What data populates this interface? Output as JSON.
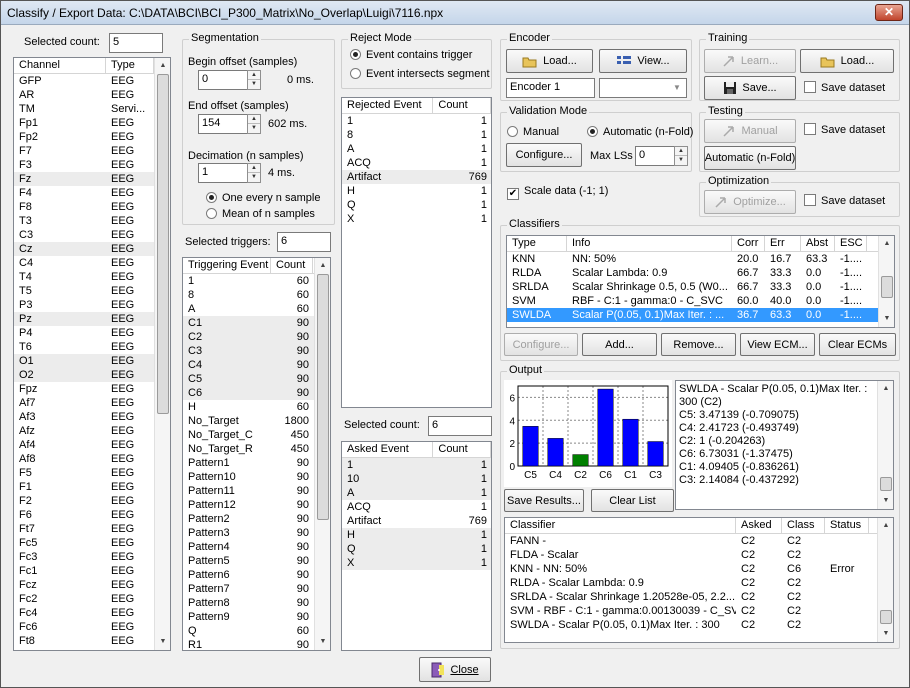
{
  "window": {
    "title": "Classify / Export Data: C:\\DATA\\BCI\\BCI_P300_Matrix\\No_Overlap\\Luigi\\7116.npx",
    "close_glyph": "✕"
  },
  "channels": {
    "selected_count_label": "Selected count:",
    "selected_count": "5",
    "headers": [
      "Channel",
      "Type"
    ],
    "rows": [
      [
        "GFP",
        "EEG",
        0
      ],
      [
        "AR",
        "EEG",
        0
      ],
      [
        "TM",
        "Servi...",
        0
      ],
      [
        "Fp1",
        "EEG",
        0
      ],
      [
        "Fp2",
        "EEG",
        0
      ],
      [
        "F7",
        "EEG",
        0
      ],
      [
        "F3",
        "EEG",
        0
      ],
      [
        "Fz",
        "EEG",
        1
      ],
      [
        "F4",
        "EEG",
        0
      ],
      [
        "F8",
        "EEG",
        0
      ],
      [
        "T3",
        "EEG",
        0
      ],
      [
        "C3",
        "EEG",
        0
      ],
      [
        "Cz",
        "EEG",
        1
      ],
      [
        "C4",
        "EEG",
        0
      ],
      [
        "T4",
        "EEG",
        0
      ],
      [
        "T5",
        "EEG",
        0
      ],
      [
        "P3",
        "EEG",
        0
      ],
      [
        "Pz",
        "EEG",
        1
      ],
      [
        "P4",
        "EEG",
        0
      ],
      [
        "T6",
        "EEG",
        0
      ],
      [
        "O1",
        "EEG",
        1
      ],
      [
        "O2",
        "EEG",
        1
      ],
      [
        "Fpz",
        "EEG",
        0
      ],
      [
        "Af7",
        "EEG",
        0
      ],
      [
        "Af3",
        "EEG",
        0
      ],
      [
        "Afz",
        "EEG",
        0
      ],
      [
        "Af4",
        "EEG",
        0
      ],
      [
        "Af8",
        "EEG",
        0
      ],
      [
        "F5",
        "EEG",
        0
      ],
      [
        "F1",
        "EEG",
        0
      ],
      [
        "F2",
        "EEG",
        0
      ],
      [
        "F6",
        "EEG",
        0
      ],
      [
        "Ft7",
        "EEG",
        0
      ],
      [
        "Fc5",
        "EEG",
        0
      ],
      [
        "Fc3",
        "EEG",
        0
      ],
      [
        "Fc1",
        "EEG",
        0
      ],
      [
        "Fcz",
        "EEG",
        0
      ],
      [
        "Fc2",
        "EEG",
        0
      ],
      [
        "Fc4",
        "EEG",
        0
      ],
      [
        "Fc6",
        "EEG",
        0
      ],
      [
        "Ft8",
        "EEG",
        0
      ]
    ]
  },
  "segmentation": {
    "title": "Segmentation",
    "begin_label": "Begin offset (samples)",
    "begin_value": "0",
    "begin_ms": "0 ms.",
    "end_label": "End offset (samples)",
    "end_value": "154",
    "end_ms": "602 ms.",
    "decim_label": "Decimation (n samples)",
    "decim_value": "1",
    "decim_ms": "4 ms.",
    "opt1": "One every n sample",
    "opt2": "Mean of n samples"
  },
  "triggers": {
    "selected_label": "Selected triggers:",
    "selected_value": "6",
    "headers": [
      "Triggering Event",
      "Count"
    ],
    "rows": [
      [
        "1",
        "60",
        0
      ],
      [
        "8",
        "60",
        0
      ],
      [
        "A",
        "60",
        0
      ],
      [
        "C1",
        "90",
        1
      ],
      [
        "C2",
        "90",
        1
      ],
      [
        "C3",
        "90",
        1
      ],
      [
        "C4",
        "90",
        1
      ],
      [
        "C5",
        "90",
        1
      ],
      [
        "C6",
        "90",
        1
      ],
      [
        "H",
        "60",
        0
      ],
      [
        "No_Target",
        "1800",
        0
      ],
      [
        "No_Target_C",
        "450",
        0
      ],
      [
        "No_Target_R",
        "450",
        0
      ],
      [
        "Pattern1",
        "90",
        0
      ],
      [
        "Pattern10",
        "90",
        0
      ],
      [
        "Pattern11",
        "90",
        0
      ],
      [
        "Pattern12",
        "90",
        0
      ],
      [
        "Pattern2",
        "90",
        0
      ],
      [
        "Pattern3",
        "90",
        0
      ],
      [
        "Pattern4",
        "90",
        0
      ],
      [
        "Pattern5",
        "90",
        0
      ],
      [
        "Pattern6",
        "90",
        0
      ],
      [
        "Pattern7",
        "90",
        0
      ],
      [
        "Pattern8",
        "90",
        0
      ],
      [
        "Pattern9",
        "90",
        0
      ],
      [
        "Q",
        "60",
        0
      ],
      [
        "R1",
        "90",
        0
      ]
    ]
  },
  "reject": {
    "title": "Reject Mode",
    "opt1": "Event contains trigger",
    "opt2": "Event intersects segment",
    "headers": [
      "Rejected Event",
      "Count"
    ],
    "rows": [
      [
        "1",
        "1",
        0
      ],
      [
        "8",
        "1",
        0
      ],
      [
        "A",
        "1",
        0
      ],
      [
        "ACQ",
        "1",
        0
      ],
      [
        "Artifact",
        "769",
        1
      ],
      [
        "H",
        "1",
        0
      ],
      [
        "Q",
        "1",
        0
      ],
      [
        "X",
        "1",
        0
      ]
    ]
  },
  "asked": {
    "selected_label": "Selected count:",
    "selected_value": "6",
    "headers": [
      "Asked Event",
      "Count"
    ],
    "rows": [
      [
        "1",
        "1",
        1
      ],
      [
        "10",
        "1",
        1
      ],
      [
        "A",
        "1",
        1
      ],
      [
        "ACQ",
        "1",
        0
      ],
      [
        "Artifact",
        "769",
        0
      ],
      [
        "H",
        "1",
        1
      ],
      [
        "Q",
        "1",
        1
      ],
      [
        "X",
        "1",
        1
      ]
    ]
  },
  "encoder": {
    "title": "Encoder",
    "load": "Load...",
    "view": "View...",
    "name": "Encoder 1",
    "combo": ""
  },
  "training": {
    "title": "Training",
    "learn": "Learn...",
    "load": "Load...",
    "save": "Save...",
    "save_dataset": "Save dataset"
  },
  "validation": {
    "title": "Validation Mode",
    "manual": "Manual",
    "automatic": "Automatic (n-Fold)",
    "configure": "Configure...",
    "max_ls_label": "Max LSs",
    "max_ls": "0"
  },
  "testing": {
    "title": "Testing",
    "manual": "Manual",
    "save_dataset": "Save dataset",
    "automatic": "Automatic (n-Fold)"
  },
  "scale": {
    "label": "Scale data (-1; 1)",
    "checked": "✔"
  },
  "optimization": {
    "title": "Optimization",
    "optimize": "Optimize...",
    "save_dataset": "Save dataset"
  },
  "classifiers": {
    "title": "Classifiers",
    "headers": [
      "Type",
      "Info",
      "Corr",
      "Err",
      "Abst",
      "ESC"
    ],
    "rows": [
      [
        "KNN",
        "NN: 50%",
        "20.0",
        "16.7",
        "63.3",
        "-1...."
      ],
      [
        "RLDA",
        "Scalar Lambda: 0.9",
        "66.7",
        "33.3",
        "0.0",
        "-1...."
      ],
      [
        "SRLDA",
        "Scalar Shrinkage 0.5, 0.5 (W0...",
        "66.7",
        "33.3",
        "0.0",
        "-1...."
      ],
      [
        "SVM",
        "RBF - C:1 - gamma:0 - C_SVC",
        "60.0",
        "40.0",
        "0.0",
        "-1...."
      ],
      [
        "SWLDA",
        "Scalar P(0.05, 0.1)Max Iter. : ...",
        "36.7",
        "63.3",
        "0.0",
        "-1...."
      ]
    ],
    "configure": "Configure...",
    "add": "Add...",
    "remove": "Remove...",
    "view_ecm": "View ECM...",
    "clear_ecms": "Clear ECMs"
  },
  "output": {
    "title": "Output",
    "save_results": "Save Results...",
    "clear_list": "Clear List",
    "text_lines": [
      "SWLDA - Scalar P(0.05, 0.1)Max Iter. :",
      "300 (C2)",
      "C5: 3.47139 (-0.709075)",
      "C4: 2.41723 (-0.493749)",
      "C2: 1 (-0.204263)",
      "C6: 6.73031 (-1.37475)",
      "C1: 4.09405 (-0.836261)",
      "C3: 2.14084 (-0.437292)"
    ],
    "results_headers": [
      "Classifier",
      "Asked",
      "Class",
      "Status"
    ],
    "results": [
      [
        "FANN -",
        "C2",
        "C2",
        ""
      ],
      [
        "FLDA - Scalar",
        "C2",
        "C2",
        ""
      ],
      [
        "KNN - NN: 50%",
        "C2",
        "C6",
        "Error"
      ],
      [
        "RLDA - Scalar Lambda: 0.9",
        "C2",
        "C2",
        ""
      ],
      [
        "SRLDA - Scalar Shrinkage 1.20528e-05, 2.2...",
        "C2",
        "C2",
        ""
      ],
      [
        "SVM - RBF - C:1 - gamma:0.00130039 - C_SVC",
        "C2",
        "C2",
        ""
      ],
      [
        "SWLDA - Scalar P(0.05, 0.1)Max Iter. : 300",
        "C2",
        "C2",
        ""
      ]
    ]
  },
  "chart_data": {
    "type": "bar",
    "categories": [
      "C5",
      "C4",
      "C2",
      "C6",
      "C1",
      "C3"
    ],
    "values": [
      3.47139,
      2.41723,
      1,
      6.73031,
      4.09405,
      2.14084
    ],
    "ylim": [
      0,
      7
    ],
    "yticks": [
      0,
      2,
      4,
      6
    ],
    "colors": [
      "#0000ff",
      "#0000ff",
      "#008000",
      "#0000ff",
      "#0000ff",
      "#0000ff"
    ],
    "grid": true,
    "title": "",
    "xlabel": "",
    "ylabel": ""
  },
  "footer": {
    "close": "Close"
  }
}
